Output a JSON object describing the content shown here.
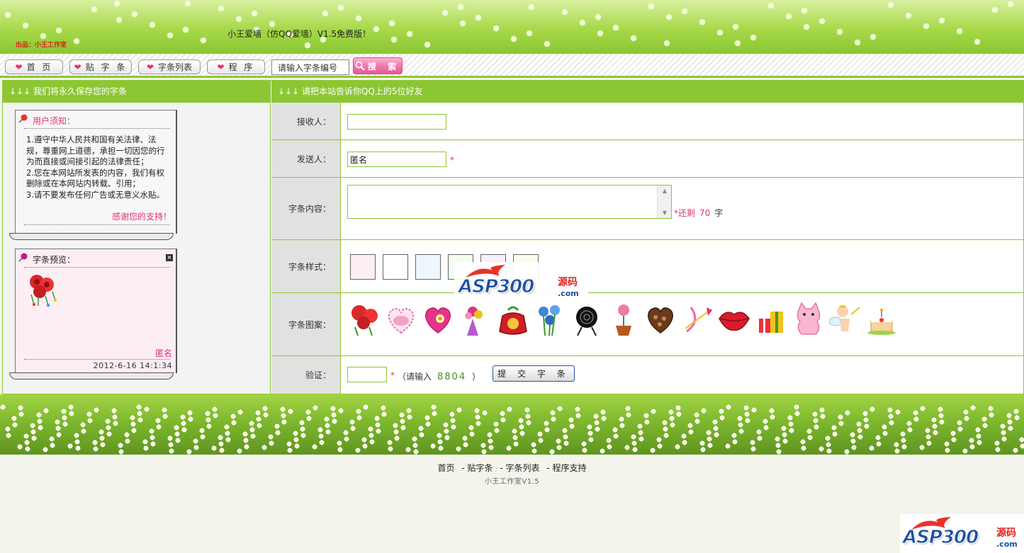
{
  "header": {
    "logo_text": "小王爱墙",
    "logo_sub": "出品：小王工作室",
    "site_title": "小王爱墙（仿QQ爱墙）V1.5免费版！"
  },
  "nav": {
    "items": [
      {
        "label": "首 页"
      },
      {
        "label": "贴 字 条"
      },
      {
        "label": "字条列表"
      },
      {
        "label": "程 序"
      }
    ],
    "search_placeholder": "请输入字条编号",
    "search_button": "搜 索"
  },
  "left": {
    "header": "↓↓↓ 我们将永久保存您的字条",
    "notice": {
      "title": "用户须知：",
      "lines": [
        "1.遵守中华人民共和国有关法律、法规，尊重网上道德，承担一切因您的行为而直接或间接引起的法律责任；",
        "2.您在本网站所发表的内容，我们有权删除或在本网站内转载、引用；",
        "3.请不要发布任何广告或无意义水贴。"
      ],
      "thanks": "感谢您的支持！"
    },
    "preview": {
      "title": "字条预览：",
      "sender": "匿名",
      "date": "2012-6-16 14:1:34"
    }
  },
  "right": {
    "header": "↓↓↓ 请把本站告诉你QQ上的5位好友",
    "receiver": {
      "label": "接收人：",
      "value": ""
    },
    "sender": {
      "label": "发送人：",
      "value": "匿名",
      "required_mark": "*"
    },
    "content": {
      "label": "字条内容：",
      "value": "",
      "remain_prefix": "*还剩",
      "remain_count": "70",
      "remain_suffix": "字"
    },
    "style": {
      "label": "字条样式：",
      "swatches": [
        "#fbeef4",
        "#ffffff",
        "#eef6fe",
        "#f2fdf0",
        "#f7effc",
        "#fdfced"
      ]
    },
    "pictures": {
      "label": "字条图案：",
      "items": [
        "rose-bouquet",
        "love-heart-ring",
        "heart-flower",
        "flower-bouquet",
        "fortune-bag",
        "blue-roses",
        "black-rose",
        "potted-flower",
        "chocolate-box",
        "cupid-bow-heart",
        "red-lips",
        "gift-boxes",
        "pink-cat",
        "cupid-angel",
        "birthday-cake"
      ]
    },
    "verify": {
      "label": "验证：",
      "required_mark": "*",
      "prompt_prefix": "（请输入",
      "code": "8804",
      "prompt_suffix": "）",
      "submit": "提 交 字 条"
    }
  },
  "watermark": {
    "asp": "ASP300",
    "yuan": "源码",
    "com": ".com"
  },
  "footer": {
    "links": [
      "首页",
      "- 贴字条",
      "- 字条列表",
      "- 程序支持"
    ],
    "sub": "小王工作室V1.5"
  },
  "colors": {
    "accent_green": "#8cc733",
    "pink": "#e0337a",
    "watermark_blue": "#1b4fa8",
    "watermark_red": "#e32121"
  }
}
